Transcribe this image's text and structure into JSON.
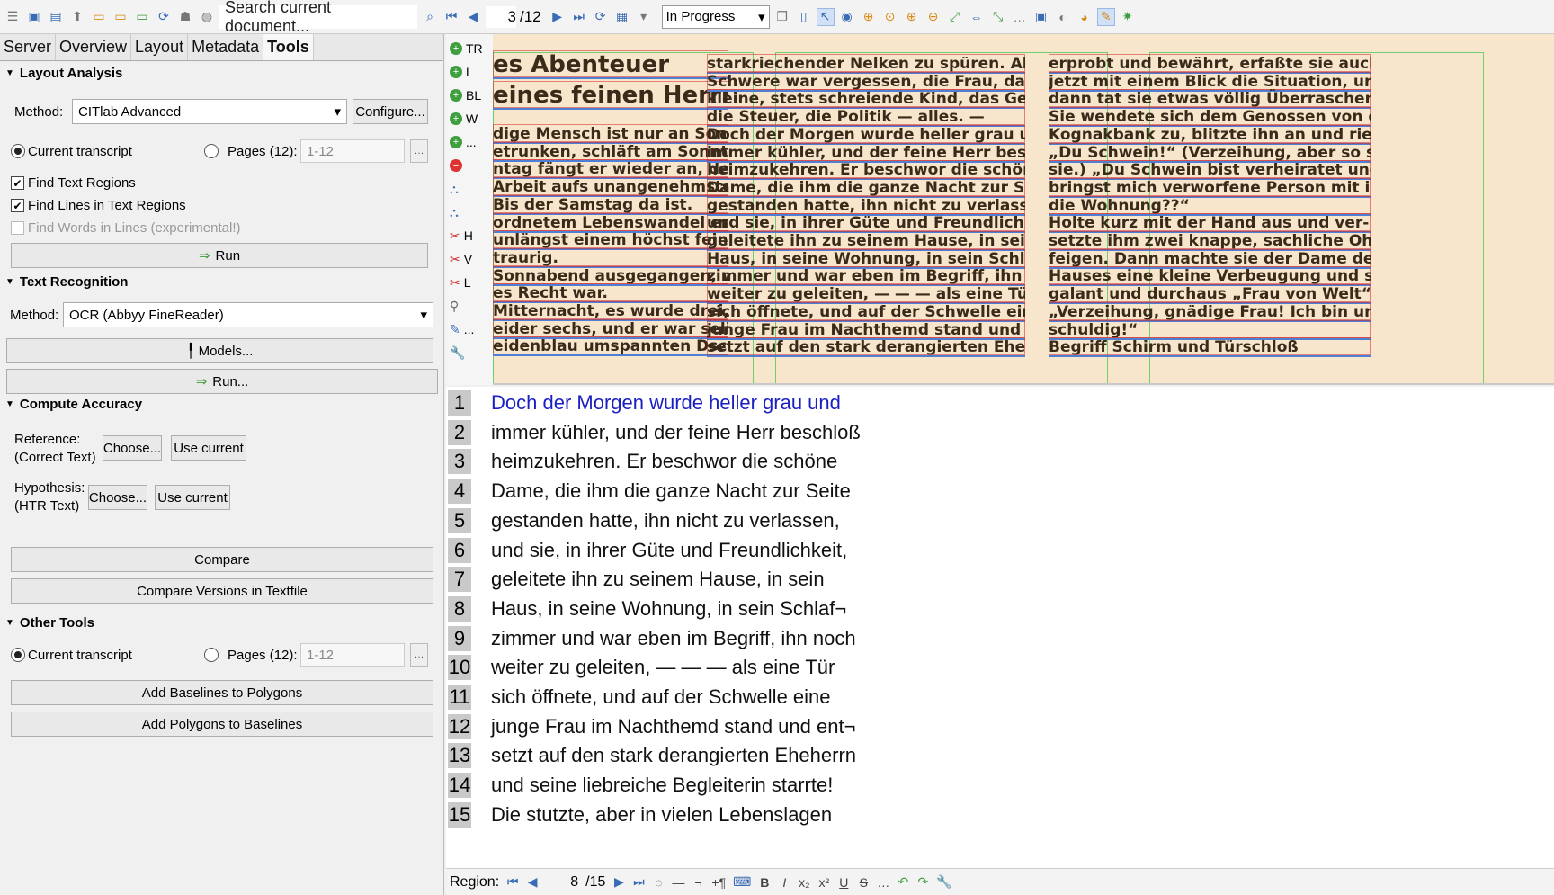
{
  "toolbar": {
    "search_placeholder": "Search current document...",
    "page_current": "3",
    "page_total": "/12",
    "status_value": "In Progress"
  },
  "tabs": [
    "Server",
    "Overview",
    "Layout",
    "Metadata",
    "Tools"
  ],
  "layout_analysis": {
    "title": "Layout Analysis",
    "method_label": "Method:",
    "method_value": "CITlab Advanced",
    "configure_label": "Configure...",
    "current_transcript_label": "Current transcript",
    "pages_label": "Pages (12):",
    "pages_value": "1-12",
    "find_text_regions": "Find Text Regions",
    "find_lines": "Find Lines in Text Regions",
    "find_words": "Find Words in Lines (experimental!)",
    "run_label": "Run"
  },
  "text_recognition": {
    "title": "Text Recognition",
    "method_label": "Method:",
    "method_value": "OCR (Abbyy FineReader)",
    "models_label": "Models...",
    "run_label": "Run..."
  },
  "compute_accuracy": {
    "title": "Compute Accuracy",
    "reference_label": "Reference:",
    "reference_sub": "(Correct Text)",
    "hypothesis_label": "Hypothesis:",
    "hypothesis_sub": "(HTR Text)",
    "choose_label": "Choose...",
    "use_current_label": "Use current",
    "compare_label": "Compare",
    "compare_versions_label": "Compare Versions in Textfile"
  },
  "other_tools": {
    "title": "Other Tools",
    "current_transcript_label": "Current transcript",
    "pages_label": "Pages (12):",
    "pages_value": "1-12",
    "baselines_to_polygons": "Add Baselines to Polygons",
    "polygons_to_baselines": "Add Polygons to Baselines"
  },
  "side_strip": [
    "TR",
    "L",
    "BL",
    "W",
    "...",
    "H",
    "V",
    "L",
    "..."
  ],
  "scan": {
    "col1": [
      "es Abenteuer",
      "eines feinen Herrn",
      "dige Mensch ist nur an Sonn-",
      "etrunken, schläft am Sonntag,",
      "ntag fängt er wieder an, den",
      "Arbeit aufs unangenehmste zu",
      "Bis der Samstag da ist.",
      "ordnetem Lebenswandel erging",
      "unlängst einem höchst feinen",
      "traurig.",
      "Sonnabend ausgegangen, wie",
      "es Recht war.",
      "Mitternacht, es wurde drei, vier,",
      "eider sechs, und er war selig,",
      "eidenblau umspannten Dschin-"
    ],
    "col2": [
      "starkriechender Nelken zu spüren. Alles",
      "Schwere war vergessen, die Frau, das",
      "kleine, stets schreiende Kind, das Geld,",
      "die Steuer, die Politik — alles. —",
      "Doch der Morgen wurde heller grau und",
      "immer kühler, und der feine Herr beschloß",
      "heimzukehren. Er beschwor die schöne",
      "Dame, die ihm die ganze Nacht zur Seite",
      "gestanden hatte, ihn nicht zu verlassen,",
      "und sie, in ihrer Güte und Freundlichkeit,",
      "geleitete ihn zu seinem Hause, in sein",
      "Haus, in seine Wohnung, in sein Schlaf-",
      "zimmer und war eben im Begriff, ihn noch",
      "weiter zu geleiten, — — — als eine Tür",
      "sich öffnete, und auf der Schwelle eine",
      "junge Frau im Nachthemd stand und ent-",
      "setzt auf den stark derangierten Eheherrn"
    ],
    "col3": [
      "erprobt und bewährt, erfaßte sie auch",
      "jetzt mit einem Blick die Situation, und",
      "dann tat sie etwas völlig Überraschendes.",
      "Sie wendete sich dem Genossen von der",
      "Kognakbank zu, blitzte ihn an und rief:",
      "„Du Schwein!“ (Verzeihung, aber so sagte",
      "sie.) „Du Schwein bist verheiratet und",
      "bringst mich verworfene Person mit in",
      "die Wohnung??“",
      "Holte kurz mit der Hand aus und ver-",
      "setzte ihm zwei knappe, sachliche Ohr-",
      "feigen. Dann machte sie der Dame des",
      "Hauses eine kleine Verbeugung und sagte",
      "galant und durchaus „Frau von Welt“ =",
      "„Verzeihung, gnädige Frau! Ich bin un-",
      "schuldig!“",
      "Begriff Schirm und Türschloß"
    ]
  },
  "transcript": [
    {
      "n": "1",
      "text": "Doch der Morgen wurde heller grau und"
    },
    {
      "n": "2",
      "text": "immer kühler, und der feine Herr beschloß"
    },
    {
      "n": "3",
      "text": "heimzukehren. Er beschwor die schöne"
    },
    {
      "n": "4",
      "text": "Dame, die ihm die ganze Nacht zur Seite"
    },
    {
      "n": "5",
      "text": "gestanden hatte, ihn nicht zu verlassen,"
    },
    {
      "n": "6",
      "text": "und sie, in ihrer Güte und Freundlichkeit,"
    },
    {
      "n": "7",
      "text": "geleitete ihn zu seinem Hause, in sein"
    },
    {
      "n": "8",
      "text": "Haus, in seine Wohnung, in sein Schlaf¬"
    },
    {
      "n": "9",
      "text": "zimmer und war eben im Begriff, ihn noch"
    },
    {
      "n": "10",
      "text": "weiter zu geleiten, — — — als eine Tür"
    },
    {
      "n": "11",
      "text": "sich öffnete, und auf der Schwelle eine"
    },
    {
      "n": "12",
      "text": "junge Frau im Nachthemd stand und ent¬"
    },
    {
      "n": "13",
      "text": "setzt auf den stark derangierten Eheherrn"
    },
    {
      "n": "14",
      "text": "und seine liebreiche Begleiterin starrte!"
    },
    {
      "n": "15",
      "text": "Die stutzte, aber in vielen Lebenslagen"
    }
  ],
  "bottom_bar": {
    "region_label": "Region:",
    "region_current": "8",
    "region_total": "/15"
  }
}
